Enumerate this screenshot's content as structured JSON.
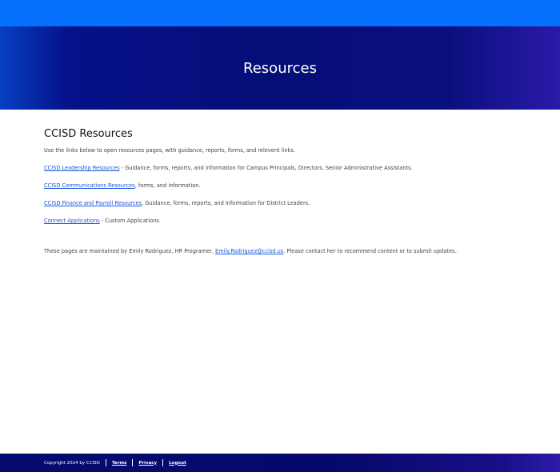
{
  "header": {
    "title": "Resources",
    "colors": {
      "topbar": "#0570fb",
      "hero": "#050e78"
    }
  },
  "main": {
    "heading": "CCISD Resources",
    "intro": "Use the links below to open resources pages, with guidance, reports, forms, and relevent links.",
    "resources": [
      {
        "link": "CCISD Leadership Resources",
        "desc": " - Guidance, forms, reports, and information for Campus Principals, Directors, Senior Administrative Assistants."
      },
      {
        "link": "CCISD Communications Resources",
        "desc": ", forms, and information."
      },
      {
        "link": "CCISD Finance and Payroll Resources",
        "desc": ", Guidance, forms, reports, and Information for District Leaders."
      },
      {
        "link": "Connect Applications",
        "desc": " - Custom Applications."
      }
    ],
    "note": {
      "prefix": "These pages are maintained by Emily Rodriguez, HR Programer, ",
      "email": "Emily.Rodriguez@ccisd.us",
      "suffix": ".  Please contact her to recommend content or to submit updates.."
    },
    "link_color": "#1a56d6"
  },
  "footer": {
    "copyright": "Copyright 2024 by CCISD",
    "links": [
      "Terms",
      "Privacy",
      "Logout"
    ]
  }
}
